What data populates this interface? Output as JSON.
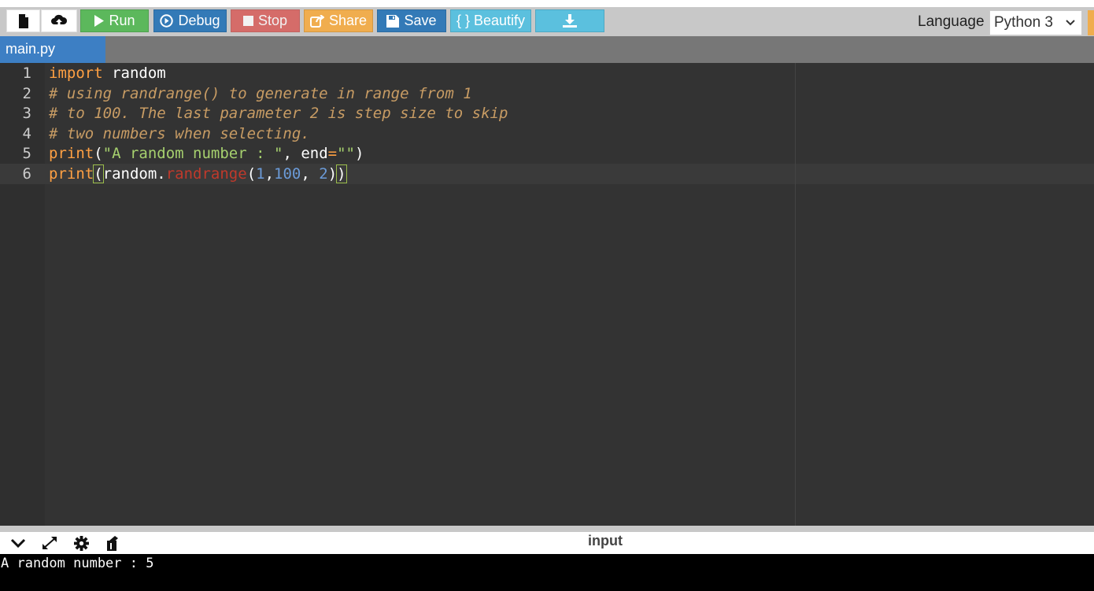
{
  "toolbar": {
    "run_label": "Run",
    "debug_label": "Debug",
    "stop_label": "Stop",
    "share_label": "Share",
    "save_label": "Save",
    "beautify_label": "{ } Beautify",
    "language_label": "Language",
    "language_value": "Python 3"
  },
  "colors": {
    "run": "#5cb85c",
    "debug": "#337ab7",
    "stop": "#d9534f",
    "share": "#f0ad4e",
    "save": "#337ab7",
    "beautify": "#5bc0de",
    "download": "#5bc0de",
    "tab_active": "#3d7fc4",
    "editor_bg": "#333333"
  },
  "tabs": [
    {
      "label": "main.py"
    }
  ],
  "editor": {
    "line_numbers": [
      "1",
      "2",
      "3",
      "4",
      "5",
      "6"
    ],
    "lines": [
      {
        "import": "import",
        "module": " random"
      },
      {
        "comment": "# using randrange() to generate in range from 1"
      },
      {
        "comment": "# to 100. The last parameter 2 is step size to skip"
      },
      {
        "comment": "# two numbers when selecting."
      },
      {
        "fn": "print",
        "open": "(",
        "str": "\"A random number : \"",
        "sep": ", ",
        "kw": "end",
        "eq": "=",
        "str2": "\"\"",
        "close": ")"
      },
      {
        "fn": "print",
        "open": "(",
        "obj": "random.",
        "method": "randrange",
        "open2": "(",
        "n1": "1",
        "c1": ",",
        "n2": "100",
        "c2": ", ",
        "n3": "2",
        "close2": ")",
        "close": ")"
      }
    ]
  },
  "bottom_panel": {
    "title": "input",
    "output": "A random number : 5"
  },
  "icons": {
    "new_file": "file-icon",
    "upload": "cloud-upload-icon",
    "run": "play-icon",
    "debug": "debug-icon",
    "stop": "stop-icon",
    "share": "share-icon",
    "save": "floppy-icon",
    "download": "download-icon",
    "collapse": "chevron-down-icon",
    "expand": "expand-icon",
    "settings": "gear-icon",
    "clear": "clear-console-icon"
  }
}
